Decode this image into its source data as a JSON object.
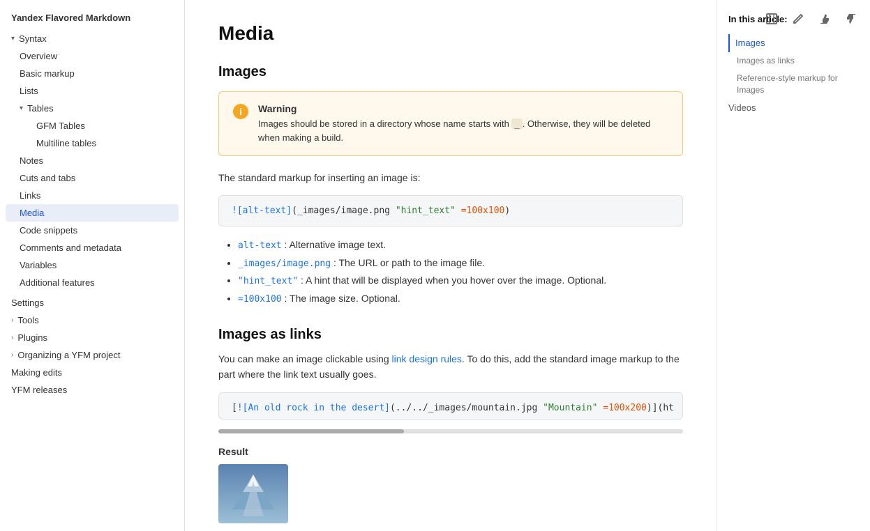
{
  "app": {
    "title": "Yandex Flavored Markdown"
  },
  "sidebar": {
    "top_title": "Yandex Flavored Markdown",
    "sections": [
      {
        "type": "group",
        "label": "Syntax",
        "expanded": true,
        "chevron": "▾",
        "items": [
          {
            "label": "Overview",
            "level": 2,
            "active": false
          },
          {
            "label": "Basic markup",
            "level": 2,
            "active": false
          },
          {
            "label": "Lists",
            "level": 2,
            "active": false
          },
          {
            "type": "subgroup",
            "label": "Tables",
            "expanded": true,
            "chevron": "▾",
            "items": [
              {
                "label": "GFM Tables",
                "level": 3,
                "active": false
              },
              {
                "label": "Multiline tables",
                "level": 3,
                "active": false
              }
            ]
          },
          {
            "label": "Notes",
            "level": 2,
            "active": false
          },
          {
            "label": "Cuts and tabs",
            "level": 2,
            "active": false
          },
          {
            "label": "Links",
            "level": 2,
            "active": false
          },
          {
            "label": "Media",
            "level": 2,
            "active": true
          },
          {
            "label": "Code snippets",
            "level": 2,
            "active": false
          },
          {
            "label": "Comments and metadata",
            "level": 2,
            "active": false
          },
          {
            "label": "Variables",
            "level": 2,
            "active": false
          },
          {
            "label": "Additional features",
            "level": 2,
            "active": false
          }
        ]
      },
      {
        "type": "top",
        "label": "Settings",
        "expanded": false
      },
      {
        "type": "top",
        "label": "Tools",
        "expanded": false,
        "chevron": "›"
      },
      {
        "type": "top",
        "label": "Plugins",
        "expanded": false,
        "chevron": "›"
      },
      {
        "type": "top",
        "label": "Organizing a YFM project",
        "expanded": false,
        "chevron": "›"
      },
      {
        "type": "top",
        "label": "Making edits",
        "expanded": false
      },
      {
        "type": "top",
        "label": "YFM releases",
        "expanded": false
      }
    ]
  },
  "main": {
    "page_title": "Media",
    "section1": {
      "title": "Images",
      "warning": {
        "title": "Warning",
        "text_before": "Images should be stored in a directory whose name starts with ",
        "code": "_",
        "text_after": ". Otherwise, they will be deleted when making a build."
      },
      "intro": "The standard markup for inserting an image is:",
      "code": "![alt-text](_images/image.png \"hint_text\" =100x100)",
      "code_parts": [
        {
          "text": "![",
          "type": "normal"
        },
        {
          "text": "alt-text",
          "type": "blue"
        },
        {
          "text": "](_images/image.png \"hint_text\" =100x100)",
          "type": "normal"
        }
      ],
      "features": [
        {
          "code": "alt-text",
          "description": ": Alternative image text."
        },
        {
          "code": "_images/image.png",
          "description": ": The URL or path to the image file."
        },
        {
          "code": "\"hint_text\"",
          "description": ": A hint that will be displayed when you hover over the image. Optional."
        },
        {
          "code": "=100x100",
          "description": ": The image size. Optional."
        }
      ]
    },
    "section2": {
      "title": "Images as links",
      "intro": "You can make an image clickable using ",
      "link_text": "link design rules",
      "intro_after": ". To do this, add the standard image markup to the part where the link text usually goes.",
      "code": "[![An old rock in the desert](../../_images/mountain.jpg \"Mountain\" =100x200)](ht",
      "result_label": "Result"
    }
  },
  "toc": {
    "title": "In this article:",
    "items": [
      {
        "label": "Images",
        "active": true,
        "sub": false
      },
      {
        "label": "Images as links",
        "active": false,
        "sub": true
      },
      {
        "label": "Reference-style markup for Images",
        "active": false,
        "sub": true
      },
      {
        "label": "Videos",
        "active": false,
        "sub": false
      }
    ]
  },
  "toolbar": {
    "expand_label": "⛶",
    "edit_label": "✎",
    "thumbup_label": "👍",
    "thumbdown_label": "👎"
  }
}
